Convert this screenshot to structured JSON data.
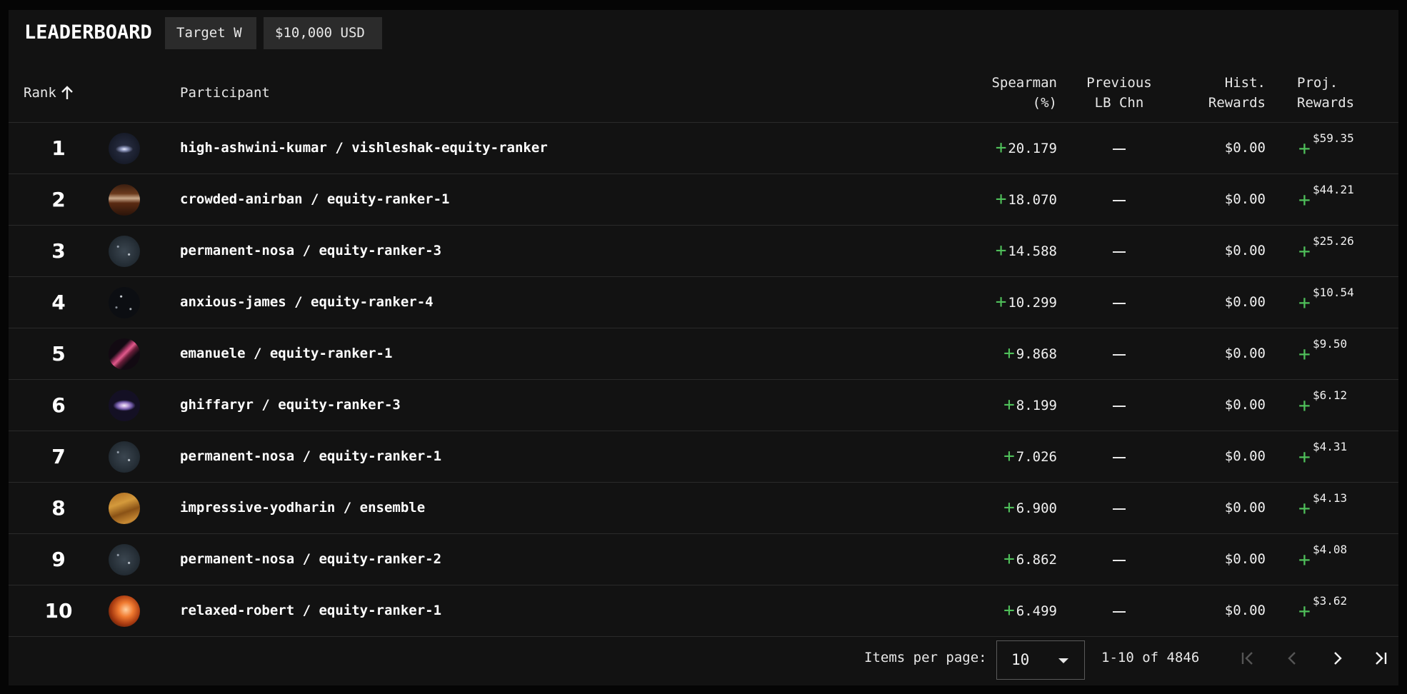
{
  "header": {
    "title": "LEADERBOARD",
    "chips": [
      "Target W",
      "$10,000 USD"
    ]
  },
  "columns": {
    "rank": "Rank",
    "participant": "Participant",
    "spearman": [
      "Spearman",
      "(%)"
    ],
    "previous": [
      "Previous",
      "LB Chn"
    ],
    "hist": [
      "Hist.",
      "Rewards"
    ],
    "proj": [
      "Proj.",
      "Rewards"
    ]
  },
  "sort_icon": "arrow-up-icon",
  "rows": [
    {
      "rank": "1",
      "participant": "high-ashwini-kumar / vishleshak-equity-ranker",
      "spearman": "20.179",
      "previous": "—",
      "hist": "$0.00",
      "proj": "$59.35",
      "avatar": "galaxy"
    },
    {
      "rank": "2",
      "participant": "crowded-anirban / equity-ranker-1",
      "spearman": "18.070",
      "previous": "—",
      "hist": "$0.00",
      "proj": "$44.21",
      "avatar": "room"
    },
    {
      "rank": "3",
      "participant": "permanent-nosa / equity-ranker-3",
      "spearman": "14.588",
      "previous": "—",
      "hist": "$0.00",
      "proj": "$25.26",
      "avatar": "stars"
    },
    {
      "rank": "4",
      "participant": "anxious-james / equity-ranker-4",
      "spearman": "10.299",
      "previous": "—",
      "hist": "$0.00",
      "proj": "$10.54",
      "avatar": "dark-stars"
    },
    {
      "rank": "5",
      "participant": "emanuele / equity-ranker-1",
      "spearman": "9.868",
      "previous": "—",
      "hist": "$0.00",
      "proj": "$9.50",
      "avatar": "nebula"
    },
    {
      "rank": "6",
      "participant": "ghiffaryr / equity-ranker-3",
      "spearman": "8.199",
      "previous": "—",
      "hist": "$0.00",
      "proj": "$6.12",
      "avatar": "spiral-galaxy"
    },
    {
      "rank": "7",
      "participant": "permanent-nosa / equity-ranker-1",
      "spearman": "7.026",
      "previous": "—",
      "hist": "$0.00",
      "proj": "$4.31",
      "avatar": "stars"
    },
    {
      "rank": "8",
      "participant": "impressive-yodharin / ensemble",
      "spearman": "6.900",
      "previous": "—",
      "hist": "$0.00",
      "proj": "$4.13",
      "avatar": "texture"
    },
    {
      "rank": "9",
      "participant": "permanent-nosa / equity-ranker-2",
      "spearman": "6.862",
      "previous": "—",
      "hist": "$0.00",
      "proj": "$4.08",
      "avatar": "stars"
    },
    {
      "rank": "10",
      "participant": "relaxed-robert / equity-ranker-1",
      "spearman": "6.499",
      "previous": "—",
      "hist": "$0.00",
      "proj": "$3.62",
      "avatar": "fire"
    }
  ],
  "footer": {
    "items_per_page_label": "Items per page:",
    "items_per_page_value": "10",
    "range_label": "1-10 of 4846"
  },
  "colors": {
    "background": "#121212",
    "accent_plus": "#4fbf5a",
    "chip": "#2b2b2b"
  }
}
